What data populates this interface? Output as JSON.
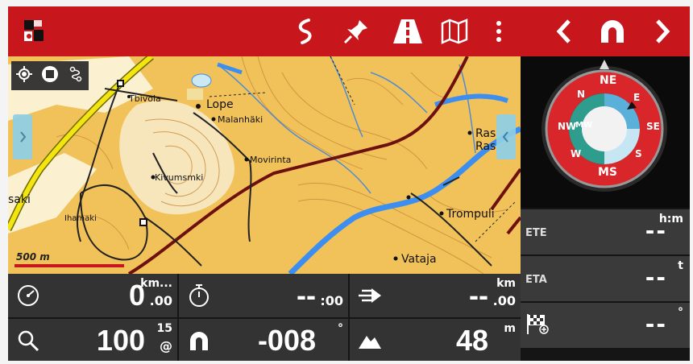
{
  "colors": {
    "brand": "#c8161d",
    "panel": "#333333",
    "map_bg": "#f2c25a",
    "compass_red": "#d8262a",
    "compass_teal": "#2e9d8e"
  },
  "topbar": {
    "icons": [
      "app-logo-icon",
      "route-icon",
      "pin-icon",
      "road-icon",
      "map-icon",
      "more-vert-icon",
      "chevron-left-icon",
      "magnet-icon",
      "chevron-right-icon"
    ]
  },
  "map": {
    "places": {
      "lope": "Lope",
      "tbivola": "Tbivola",
      "malanhaki": "Malanhäki",
      "movirinta": "Movirinta",
      "kivumaki": "Kivumsmki",
      "trompuli": "Trompuli",
      "vataja": "Vataja",
      "rasa1": "Ras",
      "rasa2": "Ras",
      "saki": "saki",
      "ihamaki": "Ihamaki"
    },
    "scale_label": "500 m"
  },
  "compass": {
    "north": "N",
    "ne": "NE",
    "e": "E",
    "se": "SE",
    "s": "S",
    "sw": "MS",
    "w": "W",
    "nw": "NW",
    "inner": "MW"
  },
  "right_stats": [
    {
      "label": "ETE",
      "value": "--",
      "unit": "h:m"
    },
    {
      "label": "ETA",
      "value": "--",
      "unit": "t"
    },
    {
      "label": "",
      "value": "--",
      "unit": "°"
    }
  ],
  "bottom": [
    {
      "icon": "speedometer-icon",
      "value": "0",
      "unit_top": "km...",
      "unit_bottom": ".00"
    },
    {
      "icon": "stopwatch-icon",
      "value": "--",
      "unit_top": "",
      "unit_bottom": ":00"
    },
    {
      "icon": "navigate-arrow-icon",
      "value": "--",
      "unit_top": "km",
      "unit_bottom": ".00"
    },
    {
      "icon": "zoom-icon",
      "value": "100",
      "unit_top": "15",
      "unit_bottom": "@"
    },
    {
      "icon": "magnet-heading-icon",
      "value": "-008",
      "unit_top": "°",
      "unit_bottom": ""
    },
    {
      "icon": "mountain-icon",
      "value": "48",
      "unit_top": "m",
      "unit_bottom": ""
    }
  ]
}
